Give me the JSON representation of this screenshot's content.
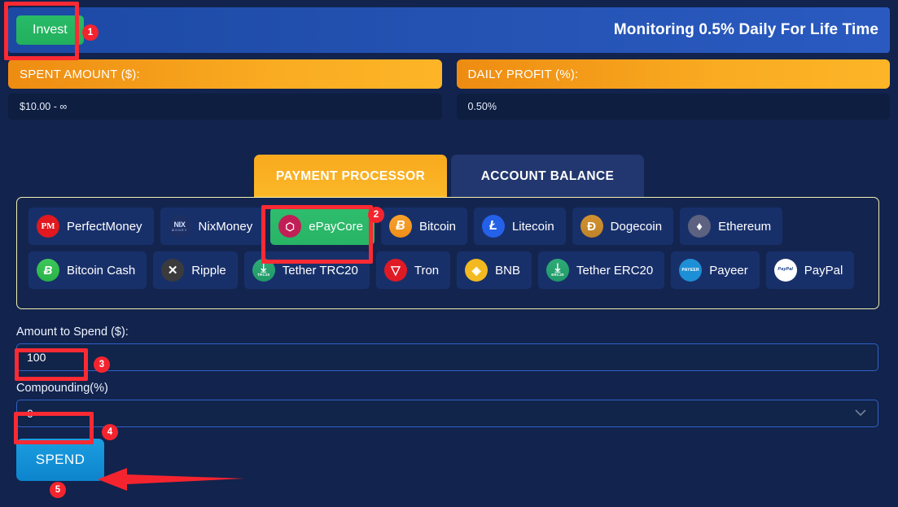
{
  "header": {
    "invest_label": "Invest",
    "title": "Monitoring 0.5% Daily For Life Time"
  },
  "stats": [
    {
      "label": "SPENT AMOUNT ($):",
      "value": "$10.00 - ∞"
    },
    {
      "label": "DAILY PROFIT (%):",
      "value": "0.50%"
    }
  ],
  "tabs": [
    {
      "label": "PAYMENT PROCESSOR",
      "active": true
    },
    {
      "label": "ACCOUNT BALANCE",
      "active": false
    }
  ],
  "processors": {
    "row1": [
      {
        "label": "PerfectMoney",
        "icon": "perfectmoney-icon",
        "selected": false
      },
      {
        "label": "NixMoney",
        "icon": "nixmoney-icon",
        "selected": false
      },
      {
        "label": "ePayCore",
        "icon": "epaycore-icon",
        "selected": true
      },
      {
        "label": "Bitcoin",
        "icon": "bitcoin-icon",
        "selected": false
      },
      {
        "label": "Litecoin",
        "icon": "litecoin-icon",
        "selected": false
      },
      {
        "label": "Dogecoin",
        "icon": "dogecoin-icon",
        "selected": false
      },
      {
        "label": "Ethereum",
        "icon": "ethereum-icon",
        "selected": false
      }
    ],
    "row2": [
      {
        "label": "Bitcoin Cash",
        "icon": "bitcoin-cash-icon",
        "selected": false
      },
      {
        "label": "Ripple",
        "icon": "ripple-icon",
        "selected": false
      },
      {
        "label": "Tether TRC20",
        "icon": "tether-trc20-icon",
        "selected": false
      },
      {
        "label": "Tron",
        "icon": "tron-icon",
        "selected": false
      },
      {
        "label": "BNB",
        "icon": "bnb-icon",
        "selected": false
      },
      {
        "label": "Tether ERC20",
        "icon": "tether-erc20-icon",
        "selected": false
      },
      {
        "label": "Payeer",
        "icon": "payeer-icon",
        "selected": false
      },
      {
        "label": "PayPal",
        "icon": "paypal-icon",
        "selected": false
      }
    ]
  },
  "icon_text": {
    "perfectmoney": "PM",
    "nixmoney": "NIX",
    "nixmoney_sub": "MONEY",
    "epaycore": "⬡",
    "bitcoin": "Ƀ",
    "litecoin": "Ł",
    "dogecoin": "Ð",
    "ethereum": "♦",
    "bitcoin_cash": "Ƀ",
    "ripple": "✕",
    "tether": "⤓",
    "tether_trc20_sub": "TRC20",
    "tether_erc20_sub": "ERC20",
    "tron": "▽",
    "bnb": "◈",
    "payeer": "PAYEER",
    "paypal": "PayPal"
  },
  "form": {
    "amount_label": "Amount to Spend ($):",
    "amount_value": "100",
    "compounding_label": "Compounding(%)",
    "compounding_value": "0",
    "dropdown_icon": "⌄",
    "spend_label": "SPEND"
  },
  "annotations": {
    "step1": "1",
    "step2": "2",
    "step3": "3",
    "step4": "4",
    "step5": "5"
  },
  "colors": {
    "page_bg": "#12234d",
    "header_blue": "#2553b4",
    "orange": "#f9ab21",
    "green": "#27b465",
    "accent_red": "#f4242f",
    "spend_blue": "#0d84cd",
    "panel_border": "#f3efb0"
  }
}
